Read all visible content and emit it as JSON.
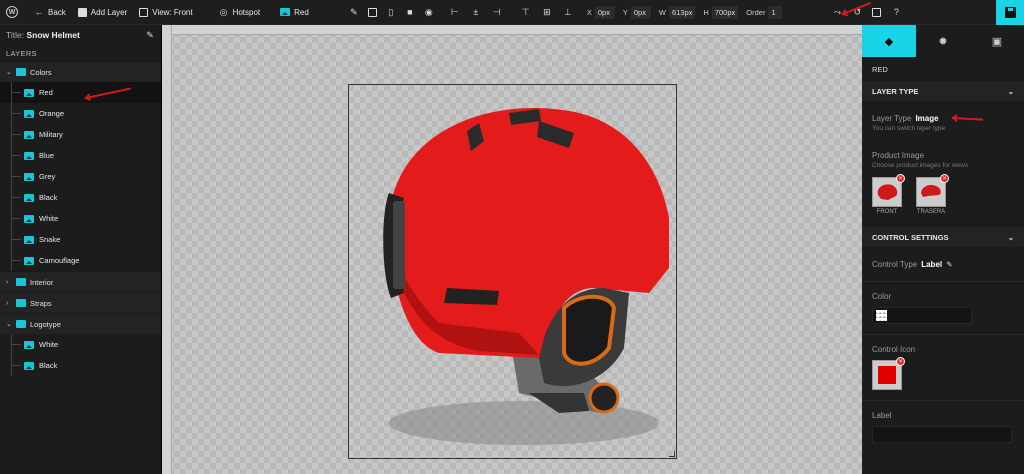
{
  "toolbar": {
    "back": "Back",
    "add_layer": "Add Layer",
    "view": "View: Front",
    "hotspot": "Hotspot",
    "current_layer": "Red",
    "x_label": "X",
    "x_value": "0px",
    "y_label": "Y",
    "y_value": "0px",
    "w_label": "W",
    "w_value": "613px",
    "h_label": "H",
    "h_value": "700px",
    "order_label": "Order",
    "order_value": "1"
  },
  "left_panel": {
    "title_label": "Title:",
    "title_value": "Snow Helmet",
    "layers_heading": "LAYERS",
    "groups": [
      {
        "label": "Colors",
        "expanded": true,
        "items": [
          "Red",
          "Orange",
          "Military",
          "Blue",
          "Grey",
          "Black",
          "White",
          "Snake",
          "Camouflage"
        ]
      },
      {
        "label": "Interior",
        "expanded": false,
        "items": []
      },
      {
        "label": "Straps",
        "expanded": false,
        "items": []
      },
      {
        "label": "Logotype",
        "expanded": true,
        "items": [
          "White",
          "Black"
        ]
      }
    ],
    "active_item": "Red"
  },
  "right_panel": {
    "layer_name": "RED",
    "layer_type_heading": "LAYER TYPE",
    "layer_type_label": "Layer Type",
    "layer_type_value": "Image",
    "layer_type_hint": "You can switch layer type",
    "product_image_label": "Product Image",
    "product_image_hint": "Choose product images for views",
    "thumbs": [
      "FRONT",
      "TRASERA"
    ],
    "control_settings_heading": "CONTROL SETTINGS",
    "control_type_label": "Control Type",
    "control_type_value": "Label",
    "color_label": "Color",
    "control_icon_label": "Control Icon",
    "label_label": "Label",
    "control_icon_color": "#e00000"
  },
  "colors": {
    "accent": "#19d4e6",
    "helmet": "#e31b1b",
    "annotation": "#d21a1a"
  }
}
